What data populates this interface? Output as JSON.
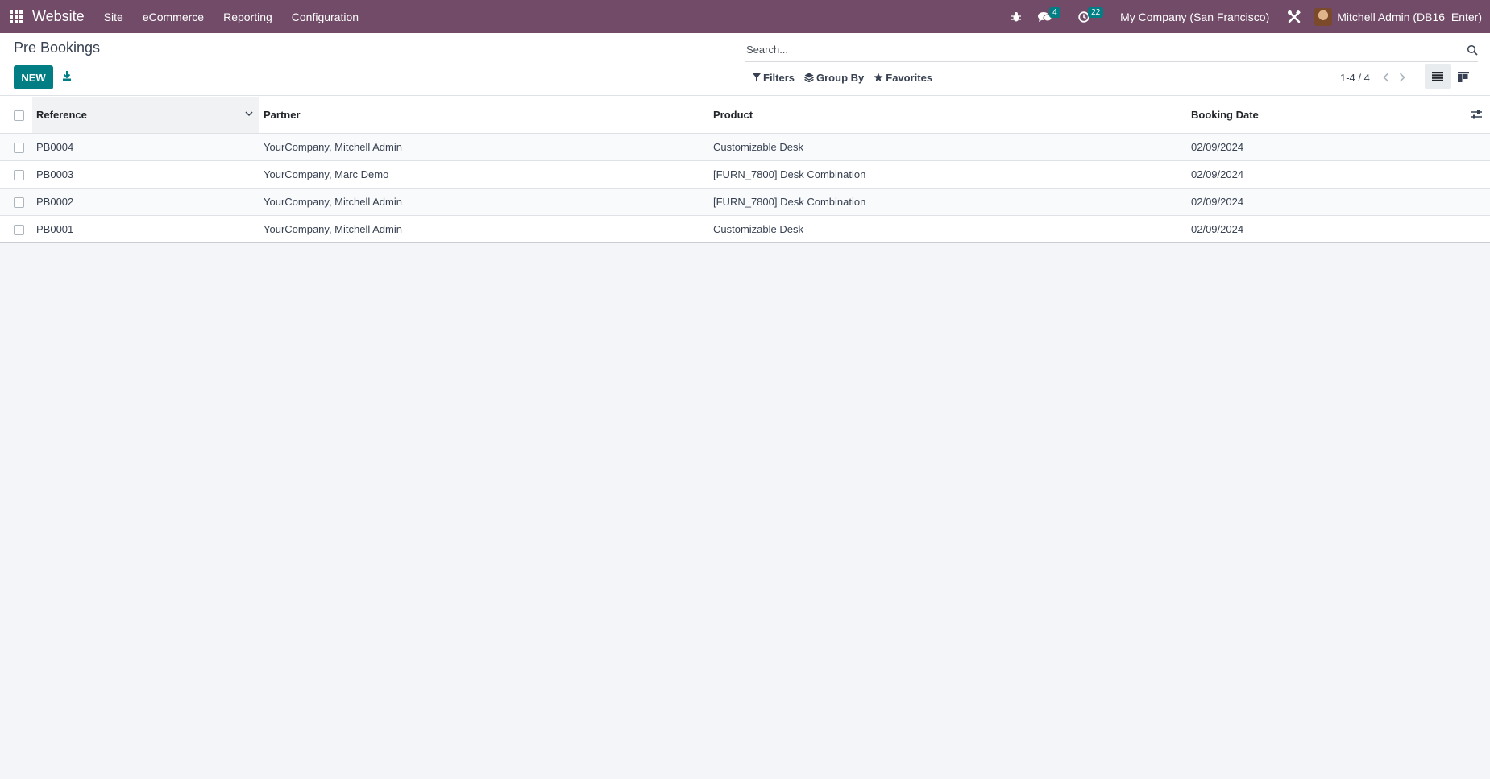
{
  "navbar": {
    "app_name": "Website",
    "menu": [
      "Site",
      "eCommerce",
      "Reporting",
      "Configuration"
    ],
    "messages_badge": "4",
    "activities_badge": "22",
    "company": "My Company (San Francisco)",
    "user": "Mitchell Admin (DB16_Enter)",
    "color": "#714b67"
  },
  "control_panel": {
    "title": "Pre Bookings",
    "new_label": "NEW",
    "search_placeholder": "Search...",
    "filters_label": "Filters",
    "group_by_label": "Group By",
    "favorites_label": "Favorites",
    "pager": "1-4 / 4"
  },
  "table": {
    "columns": [
      "Reference",
      "Partner",
      "Product",
      "Booking Date"
    ],
    "rows": [
      [
        "PB0004",
        "YourCompany, Mitchell Admin",
        "Customizable Desk",
        "02/09/2024"
      ],
      [
        "PB0003",
        "YourCompany, Marc Demo",
        "[FURN_7800] Desk Combination",
        "02/09/2024"
      ],
      [
        "PB0002",
        "YourCompany, Mitchell Admin",
        "[FURN_7800] Desk Combination",
        "02/09/2024"
      ],
      [
        "PB0001",
        "YourCompany, Mitchell Admin",
        "Customizable Desk",
        "02/09/2024"
      ]
    ]
  },
  "colors": {
    "primary": "#017e84",
    "background": "#f4f5f8"
  }
}
